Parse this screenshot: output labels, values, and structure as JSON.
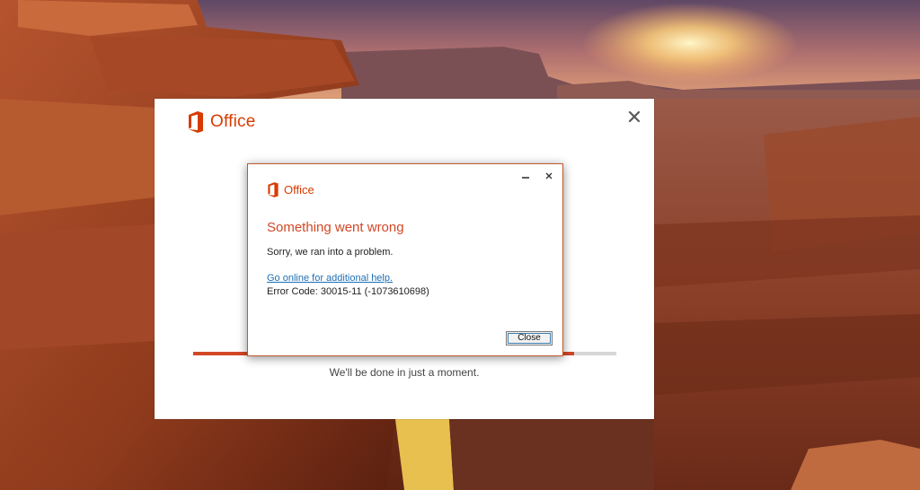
{
  "installer": {
    "brand": "Office",
    "close_icon": "close-icon",
    "progress": 0.9,
    "status": "We'll be done in just a moment."
  },
  "error_dialog": {
    "brand": "Office",
    "minimize_icon": "minimize-icon",
    "close_icon": "close-icon",
    "title": "Something went wrong",
    "message": "Sorry, we ran into a problem.",
    "help_link": "Go online for additional help.",
    "error_code": "Error Code: 30015-11 (-1073610698)",
    "close_button": "Close"
  },
  "colors": {
    "office_orange": "#d83b01",
    "title_orange": "#d24726",
    "link_blue": "#1e6fb5"
  }
}
